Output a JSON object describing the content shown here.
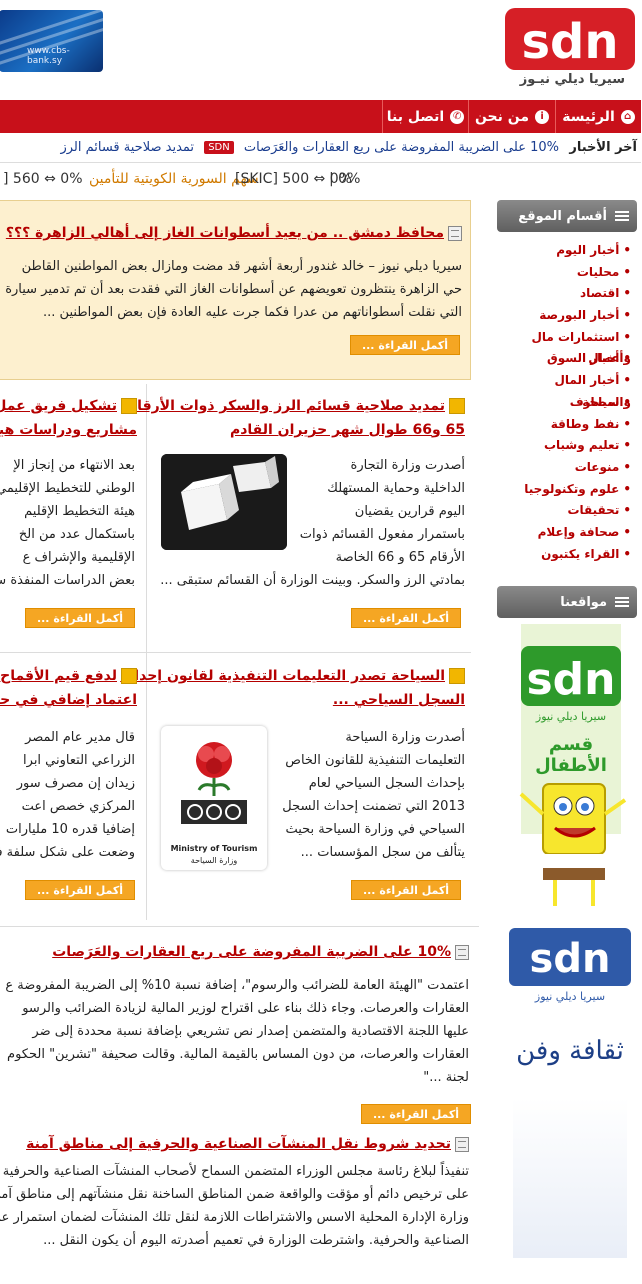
{
  "header": {
    "logo_text": "sdn",
    "logo_subtitle": "سيريا ديلي نيـوز",
    "bank_url": "www.cbs-bank.sy"
  },
  "nav": {
    "home": "الرئيسة",
    "about": "من نحن",
    "contact": "اتصل بنا"
  },
  "ticker1": {
    "label": "آخر الأخبار",
    "item1": "10% على الضريبة المفروضة على ريع العقارات والعَرَصات",
    "badge": "SDN",
    "item2": "تمديد صلاحية قسائم الرز"
  },
  "ticker2": {
    "a": "0% ⇔ 560 [",
    "b": "سهم السورية الكويتية للتأمين",
    "c": "0% ⇔ 500 [SKIC]",
    "d": "0% |"
  },
  "sidebar": {
    "sections_title": "أقسام الموقع",
    "categories": [
      "أخبار اليوم",
      "محليات",
      "اقتصاد",
      "أخبار البورصة",
      "استثمارات مال وأعمال",
      "أخبار السوق",
      "أخبار المال والمصارف",
      "سياحة",
      "نفط وطاقة",
      "تعليم وشباب",
      "منوعات",
      "علوم وتكنولوجيا",
      "تحقيقات",
      "صحافة وإعلام",
      "القراء يكتبون"
    ],
    "sites_title": "مواقعنا",
    "kids_banner": "قسم الأطفال",
    "culture_banner": "ثقافة وفن"
  },
  "featured": {
    "title": "محافظ دمشق .. من يعيد أسطوانات الغاز إلى أهالي الزاهرة ؟؟؟",
    "line1": "سيريا ديلي نيوز –  خالد غندور   أربعة أشهر قد مضت ومازال بعض المواطنين القاطن",
    "line2": "حي الزاهرة ينتظرون تعويضهم عن أسطوانات الغاز التي فقدت بعد أن تم تدمير سيارة ا",
    "line3": "التي نقلت أسطواناتهم من عدرا فكما جرت عليه العادة فإن بعض المواطنين ...",
    "more": "أكمل القراءة ..."
  },
  "grid": {
    "a1_title1": "تمديد صلاحية قسائم الرز والسكر ذوات الأرقام",
    "a1_title2": "65 و66 طوال شهر حزيران القادم",
    "a1_lines": [
      "أصدرت وزارة التجارة",
      "الداخلية وحماية المستهلك",
      "اليوم قرارين يقضيان",
      "باستمرار مفعول القسائم ذوات",
      "الأرقام 65 و 66 الخاصة",
      "بمادتي الرز والسكر. وبينت الوزارة أن القسائم ستبقى ..."
    ],
    "a2_title1": "تشكيل فريق عمل لدر",
    "a2_title2": "مشاريع ودراسات هيكلي",
    "a2_lines": [
      "بعد الانتهاء من إنجاز الإ",
      "الوطني للتخطيط الإقليمي ت",
      "هيئة التخطيط الإقليم",
      "باستكمال عدد من الخ",
      "الإقليمية والإشراف ع",
      "بعض الدراسات المنفذة ساب"
    ],
    "a3_title1": "السياحة تصدر التعليمات التنفيذية لقانون إحداث",
    "a3_title2": "السجل السياحي ...",
    "a3_lines": [
      "أصدرت وزارة السياحة",
      "التعليمات التنفيذية للقانون الخاص",
      "بإحداث السجل السياحي لعام",
      "2013 التي تضمنت إحداث السجل",
      "السياحي في وزارة السياحة بحيث",
      "يتألف من سجل المؤسسات ..."
    ],
    "a3_logo_caption1": "Ministry of Tourism",
    "a3_logo_caption2": "وزارة السياحة",
    "a4_title1": "لدفع قيم الأقماح المش",
    "a4_title2": "اعتماد إضافي في حساب",
    "a4_lines": [
      "قال مدير عام المصر",
      "الزراعي التعاوني ابرا",
      "زيدان إن مصرف سور",
      "المركزي خصص اعت",
      "إضافيا قدره 10 مليارات",
      "وضعت على شكل سلفة في"
    ],
    "more": "أكمل القراءة ..."
  },
  "list": {
    "b1_title": "10% على الضريبة المفروضة على ريع العقارات والعَرَصات",
    "b1_lines": [
      "اعتمدت \"الهيئة العامة للضرائب والرسوم\"، إضافة نسبة 10% إلى الضريبة المفروضة ع",
      "العقارات والعرصات. وجاء ذلك بناء على اقتراح لوزير المالية لزيادة الضرائب والرسو",
      "عليها اللجنة الاقتصادية والمتضمن إصدار نص تشريعي بإضافة نسبة محددة إلى ضر",
      "العقارات والعرصات، من دون المساس بالقيمة المالية. وقالت صحيفة \"تشرين\" الحكوم",
      "لجنة ...\""
    ],
    "b2_title": "تحديد شروط نقل المنشآت الصناعية والحرفية إلى مناطق آمنة",
    "b2_lines": [
      "تنفيذاً لبلاغ رئاسة مجلس الوزراء المتضمن السماح لأصحاب المنشآت الصناعية والحرفية ا",
      "على ترخيص دائم أو مؤقت والواقعة ضمن المناطق الساخنة نقل منشآتهم إلى مناطق آمن",
      "وزارة الإدارة المحلية الاسس والاشتراطات اللازمة لنقل تلك المنشآت لضمان استمرار عمل ",
      "الصناعية والحرفية. واشترطت الوزارة في تعميم أصدرته اليوم أن يكون النقل ..."
    ],
    "more": "أكمل القراءة ..."
  }
}
